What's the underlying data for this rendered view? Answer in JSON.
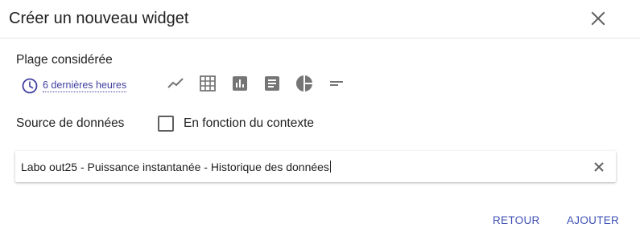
{
  "dialog": {
    "title": "Créer un nouveau widget"
  },
  "range": {
    "label": "Plage considérée",
    "value": "6 dernières heures"
  },
  "widget_types": [
    {
      "icon": "line-chart-icon"
    },
    {
      "icon": "table-grid-icon"
    },
    {
      "icon": "bar-chart-icon"
    },
    {
      "icon": "text-document-icon"
    },
    {
      "icon": "pie-chart-icon"
    },
    {
      "icon": "short-text-icon"
    }
  ],
  "source": {
    "label": "Source de données",
    "context_checkbox_label": "En fonction du contexte",
    "context_checked": false,
    "selected_value": "Labo out25 - Puissance instantanée - Historique des données"
  },
  "actions": {
    "back_label": "RETOUR",
    "add_label": "AJOUTER"
  },
  "colors": {
    "accent": "#3f51b5",
    "link": "#3f3fa0",
    "icon": "#757575"
  }
}
